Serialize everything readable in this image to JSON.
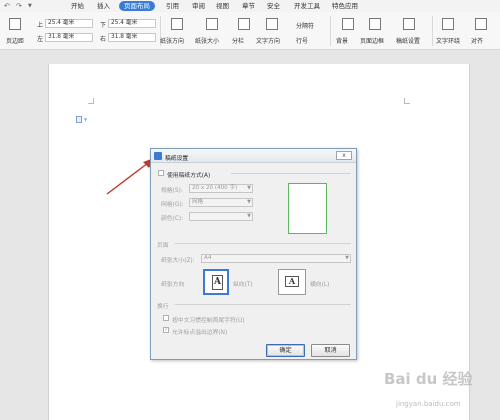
{
  "ribbon_tabs": [
    "开始",
    "插入",
    "页面布局",
    "引用",
    "审阅",
    "视图",
    "章节",
    "安全",
    "开发工具",
    "特色应用"
  ],
  "active_tab": "页面布局",
  "ribbon": {
    "margins_label": "页边距",
    "top_label": "上",
    "top_value": "25.4 毫米",
    "bottom_label": "下",
    "bottom_value": "25.4 毫米",
    "left_label": "左",
    "left_value": "31.8 毫米",
    "right_label": "右",
    "right_value": "31.8 毫米",
    "orientation": "纸张方向",
    "size": "纸张大小",
    "columns": "分栏",
    "text_direction": "文字方向",
    "breaks": "分隔符",
    "line_numbers": "行号",
    "background": "背景",
    "page_border": "页面边框",
    "paper_setup": "稿纸设置",
    "text_wrap": "文字环绕",
    "align": "对齐"
  },
  "dialog": {
    "title": "稿纸设置",
    "use_grid": "使用稿纸方式(A)",
    "spec_label": "规格(S):",
    "spec_value": "20 x 20 (400 字)",
    "grid_label": "网格(G):",
    "grid_value": "网格",
    "color_label": "颜色(C):",
    "page_section": "页面",
    "paper_size_label": "纸张大小(Z):",
    "paper_size_value": "A4",
    "orientation_label": "纸张方向",
    "portrait": "纵向(T)",
    "landscape": "横向(L)",
    "wrap_section": "换行",
    "wrap_option1": "按中文习惯控制首尾字符(U)",
    "wrap_option2": "允许标点溢出边界(N)",
    "ok": "确定",
    "cancel": "取消",
    "close": "x"
  },
  "watermark": {
    "brand": "Bai du 经验",
    "url": "jingyan.baidu.com"
  },
  "colors": {
    "accent": "#3a7bd5",
    "arrow": "#c0392b",
    "preview_border": "#5cb85c"
  }
}
